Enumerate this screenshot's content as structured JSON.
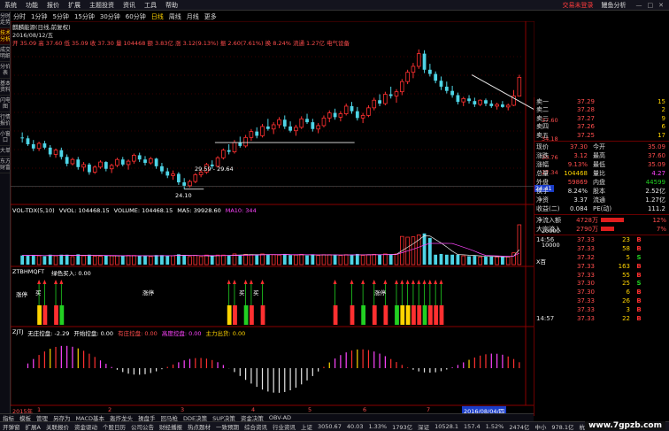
{
  "menu": {
    "items": [
      "系统",
      "功能",
      "报价",
      "扩展",
      "主题投资",
      "资讯",
      "工具",
      "帮助"
    ],
    "right_text": "交易未登录",
    "right_text2": "鳗鱼分析",
    "window_buttons": [
      "—",
      "□",
      "✕"
    ]
  },
  "left_tabs": [
    "分时走势",
    "技术分析",
    "成交明细",
    "分价表",
    "基本资料",
    "闪电图",
    "行情报价",
    "小窗口",
    "大单",
    "东方财富"
  ],
  "period_bar": [
    "分时",
    "1分钟",
    "5分钟",
    "15分钟",
    "30分钟",
    "60分钟",
    "日线",
    "周线",
    "月线",
    "更多"
  ],
  "period_selected": "日线",
  "header_text": {
    "title": "麒麟能源(日线,前复权)",
    "date": "2016/08/12/五",
    "price_line": "开 35.09 高 37.60 低 35.09 收 37.30 量 104468 额 3.83亿 涨 3.12(9.13%) 振 2.60(7.61%) 换 8.24% 流通 1.27亿 电气设备"
  },
  "price_axis": [
    "37.60",
    "34.18",
    "30.76",
    "27.34",
    "24.41"
  ],
  "price_axis_highlight": "24.41",
  "annotations": {
    "range": "29.59 - 29.64",
    "low": "24.10"
  },
  "vol_header": {
    "title": "VOL-TDX(5,10)",
    "vvol": "VVOL: 104468.15",
    "volume": "VOLUME: 104468.15",
    "ma5": "MA5: 39928.60",
    "ma10": "MA10: 344"
  },
  "vol_axis": [
    "20000",
    "10000",
    "X百"
  ],
  "ztb_header": {
    "title": "ZTBHMQFT",
    "label": "绿色买入: 0.00"
  },
  "ztb_labels": [
    "涨停",
    "买",
    "涨停",
    "买",
    "买",
    "涨停"
  ],
  "zjtj_header": {
    "title": "ZJTJ",
    "wuzhuang": "无庄控盘: -2.29",
    "kaishi": "开始控盘: 0.00",
    "youzhuang": "有庄控盘: 0.00",
    "gaodu": "高度控盘: 0.00",
    "zhuli": "主力出货: 0.00"
  },
  "date_axis": [
    "2015年",
    "1",
    "2",
    "3",
    "4",
    "5",
    "6",
    "7"
  ],
  "date_axis_highlight": "2016/08/04/四",
  "order_book": {
    "sells": [
      {
        "label": "卖一",
        "price": "37.29",
        "vol": "15"
      },
      {
        "label": "卖二",
        "price": "37.28",
        "vol": "2"
      },
      {
        "label": "卖三",
        "price": "37.27",
        "vol": "9"
      },
      {
        "label": "卖四",
        "price": "37.26",
        "vol": "6"
      },
      {
        "label": "卖五",
        "price": "37.25",
        "vol": "17"
      }
    ]
  },
  "stats": [
    {
      "k1": "现价",
      "v1": "37.30",
      "c1": "up",
      "k2": "今开",
      "v2": "35.09",
      "c2": "up"
    },
    {
      "k1": "涨跌",
      "v1": "3.12",
      "c1": "up",
      "k2": "最高",
      "v2": "37.60",
      "c2": "up"
    },
    {
      "k1": "涨幅",
      "v1": "9.13%",
      "c1": "up",
      "k2": "最低",
      "v2": "35.09",
      "c2": "up"
    },
    {
      "k1": "总量",
      "v1": "104468",
      "c1": "yel",
      "k2": "量比",
      "v2": "4.27",
      "c2": "mag"
    },
    {
      "k1": "外盘",
      "v1": "59869",
      "c1": "up",
      "k2": "内盘",
      "v2": "44599",
      "c2": "down"
    },
    {
      "k1": "换手",
      "v1": "8.24%",
      "c1": "wh",
      "k2": "股本",
      "v2": "2.52亿",
      "c2": "wh"
    },
    {
      "k1": "净资",
      "v1": "3.37",
      "c1": "wh",
      "k2": "流通",
      "v2": "1.27亿",
      "c2": "wh"
    },
    {
      "k1": "收益(二)",
      "v1": "0.084",
      "c1": "wh",
      "k2": "PE(动)",
      "v2": "111.2",
      "c2": "wh"
    }
  ],
  "flows": [
    {
      "k": "净流入额",
      "v": "4728万",
      "pct": "12%"
    },
    {
      "k": "大宗流入",
      "v": "2790万",
      "pct": "7%"
    }
  ],
  "ticks": [
    {
      "t": "14:56",
      "p": "37.33",
      "v": "23",
      "d": "B"
    },
    {
      "t": "",
      "p": "37.33",
      "v": "58",
      "d": "B"
    },
    {
      "t": "",
      "p": "37.32",
      "v": "5",
      "d": "S"
    },
    {
      "t": "",
      "p": "37.33",
      "v": "163",
      "d": "B"
    },
    {
      "t": "",
      "p": "37.33",
      "v": "55",
      "d": "B"
    },
    {
      "t": "",
      "p": "37.30",
      "v": "25",
      "d": "S"
    },
    {
      "t": "",
      "p": "37.30",
      "v": "6",
      "d": "B"
    },
    {
      "t": "",
      "p": "37.33",
      "v": "26",
      "d": "B"
    },
    {
      "t": "",
      "p": "37.33",
      "v": "3",
      "d": "B"
    },
    {
      "t": "14:57",
      "p": "37.33",
      "v": "22",
      "d": "B"
    }
  ],
  "bottom_tabs1": [
    "指标",
    "模板",
    "管理",
    "另存为",
    "MACD基本",
    "轰炸龙头",
    "操盘手",
    "回马枪",
    "DDE决策",
    "SUP决策",
    "资金决策",
    "OBV-AD"
  ],
  "bottom_tabs2": [
    "开弹窗",
    "扩展A",
    "关联报价",
    "资金驱动",
    "个股日历",
    "公司公告",
    "财经播报",
    "热点题材",
    "一致预期",
    "综合资讯",
    "行业资讯"
  ],
  "status_bar": {
    "sh_label": "上证",
    "sh_val": "3050.67",
    "sh_chg": "40.03",
    "sh_pct": "1.33%",
    "sh_amt": "1793亿",
    "sz_label": "深证",
    "sz_val": "10528.1",
    "sz_chg": "157.4",
    "sz_pct": "1.52%",
    "sz_amt": "2474亿",
    "zx_label": "中小",
    "zx_val": "978.1亿",
    "city": "杭州电信747",
    "watermark": "www.7gpzb.com"
  },
  "chart_data": {
    "type": "candlestick",
    "title": "麒麟能源(日线,前复权)",
    "ylim": [
      22.5,
      41
    ],
    "candles": [
      [
        30.2,
        30.8,
        29.6,
        30.1
      ],
      [
        30.1,
        30.4,
        29.2,
        29.4
      ],
      [
        29.4,
        29.9,
        28.6,
        28.9
      ],
      [
        28.9,
        29.7,
        28.6,
        29.5
      ],
      [
        29.5,
        29.8,
        28.8,
        29.0
      ],
      [
        29.0,
        29.3,
        27.9,
        28.2
      ],
      [
        28.2,
        28.9,
        27.8,
        28.7
      ],
      [
        28.7,
        29.0,
        27.6,
        27.9
      ],
      [
        27.9,
        28.2,
        26.8,
        27.1
      ],
      [
        27.1,
        27.8,
        26.9,
        27.6
      ],
      [
        27.6,
        27.9,
        26.4,
        26.7
      ],
      [
        26.7,
        27.3,
        26.2,
        27.0
      ],
      [
        27.0,
        27.2,
        25.8,
        26.1
      ],
      [
        26.1,
        26.9,
        25.9,
        26.7
      ],
      [
        26.7,
        27.5,
        26.5,
        27.3
      ],
      [
        27.3,
        27.4,
        26.2,
        26.5
      ],
      [
        26.5,
        27.1,
        26.0,
        26.9
      ],
      [
        26.9,
        27.8,
        26.7,
        27.6
      ],
      [
        27.6,
        27.9,
        26.8,
        27.0
      ],
      [
        27.0,
        27.6,
        26.4,
        27.4
      ],
      [
        27.4,
        28.3,
        27.1,
        28.1
      ],
      [
        28.1,
        28.4,
        27.3,
        27.6
      ],
      [
        27.6,
        28.0,
        26.9,
        27.2
      ],
      [
        27.2,
        27.9,
        27.0,
        27.7
      ],
      [
        27.7,
        27.8,
        26.5,
        26.8
      ],
      [
        26.8,
        27.2,
        25.9,
        26.2
      ],
      [
        26.2,
        26.6,
        25.4,
        25.7
      ],
      [
        25.7,
        26.3,
        25.2,
        25.9
      ],
      [
        25.9,
        26.1,
        24.6,
        24.9
      ],
      [
        24.9,
        25.4,
        24.1,
        24.5
      ],
      [
        24.5,
        25.2,
        24.3,
        25.0
      ],
      [
        25.0,
        26.0,
        24.8,
        25.8
      ],
      [
        25.8,
        26.4,
        25.5,
        26.1
      ],
      [
        26.1,
        27.2,
        25.9,
        27.0
      ],
      [
        27.0,
        27.5,
        26.5,
        26.8
      ],
      [
        26.8,
        28.0,
        26.7,
        27.8
      ],
      [
        27.8,
        28.9,
        27.6,
        28.7
      ],
      [
        28.7,
        29.4,
        28.2,
        28.5
      ],
      [
        28.5,
        29.9,
        28.3,
        29.6
      ],
      [
        29.6,
        30.3,
        29.0,
        29.2
      ],
      [
        29.2,
        30.5,
        29.0,
        30.2
      ],
      [
        30.2,
        31.2,
        29.8,
        30.9
      ],
      [
        30.9,
        31.4,
        30.1,
        30.4
      ],
      [
        30.4,
        31.8,
        30.2,
        31.5
      ],
      [
        31.5,
        32.4,
        31.0,
        31.2
      ],
      [
        31.2,
        32.0,
        30.6,
        31.7
      ],
      [
        31.7,
        32.6,
        31.3,
        32.3
      ],
      [
        32.3,
        32.8,
        31.2,
        31.5
      ],
      [
        31.5,
        32.1,
        30.8,
        31.0
      ],
      [
        31.0,
        31.7,
        30.4,
        31.4
      ],
      [
        31.4,
        32.7,
        31.2,
        32.4
      ],
      [
        32.4,
        33.0,
        31.8,
        32.0
      ],
      [
        32.0,
        32.4,
        30.9,
        31.2
      ],
      [
        31.2,
        31.9,
        30.7,
        31.6
      ],
      [
        31.6,
        32.8,
        31.4,
        32.5
      ],
      [
        32.5,
        33.4,
        32.0,
        33.1
      ],
      [
        33.1,
        33.6,
        32.3,
        32.6
      ],
      [
        32.6,
        33.3,
        32.1,
        33.0
      ],
      [
        33.0,
        34.2,
        32.8,
        33.9
      ],
      [
        33.9,
        34.4,
        33.0,
        33.3
      ],
      [
        33.3,
        33.8,
        32.2,
        32.5
      ],
      [
        32.5,
        33.1,
        31.9,
        32.8
      ],
      [
        32.8,
        34.0,
        32.6,
        33.7
      ],
      [
        33.7,
        34.9,
        33.4,
        34.6
      ],
      [
        34.6,
        35.3,
        33.9,
        34.2
      ],
      [
        34.2,
        35.6,
        34.0,
        35.3
      ],
      [
        35.3,
        36.2,
        34.8,
        35.1
      ],
      [
        35.1,
        35.9,
        34.3,
        35.6
      ],
      [
        35.6,
        37.1,
        35.2,
        36.8
      ],
      [
        36.8,
        38.2,
        36.5,
        37.9
      ],
      [
        37.9,
        39.0,
        37.2,
        38.6
      ],
      [
        38.6,
        40.6,
        38.3,
        40.1
      ],
      [
        40.1,
        40.5,
        37.8,
        38.2
      ],
      [
        38.2,
        38.9,
        37.4,
        37.7
      ],
      [
        37.7,
        38.0,
        36.6,
        36.9
      ],
      [
        36.9,
        37.4,
        35.8,
        36.2
      ],
      [
        36.2,
        36.8,
        35.4,
        35.7
      ],
      [
        35.7,
        36.3,
        34.9,
        35.2
      ],
      [
        35.2,
        35.5,
        34.1,
        34.4
      ],
      [
        34.4,
        35.0,
        33.9,
        34.8
      ],
      [
        34.8,
        35.2,
        34.2,
        34.5
      ],
      [
        34.5,
        34.9,
        33.8,
        34.1
      ],
      [
        34.1,
        34.7,
        33.9,
        34.6
      ],
      [
        34.6,
        34.8,
        33.9,
        34.2
      ],
      [
        34.2,
        34.6,
        33.7,
        33.9
      ],
      [
        33.9,
        34.3,
        33.5,
        34.1
      ],
      [
        34.1,
        34.5,
        33.7,
        33.8
      ],
      [
        33.8,
        34.2,
        33.4,
        34.0
      ],
      [
        34.0,
        35.8,
        33.9,
        35.1
      ],
      [
        35.09,
        37.6,
        35.09,
        37.3
      ]
    ]
  }
}
